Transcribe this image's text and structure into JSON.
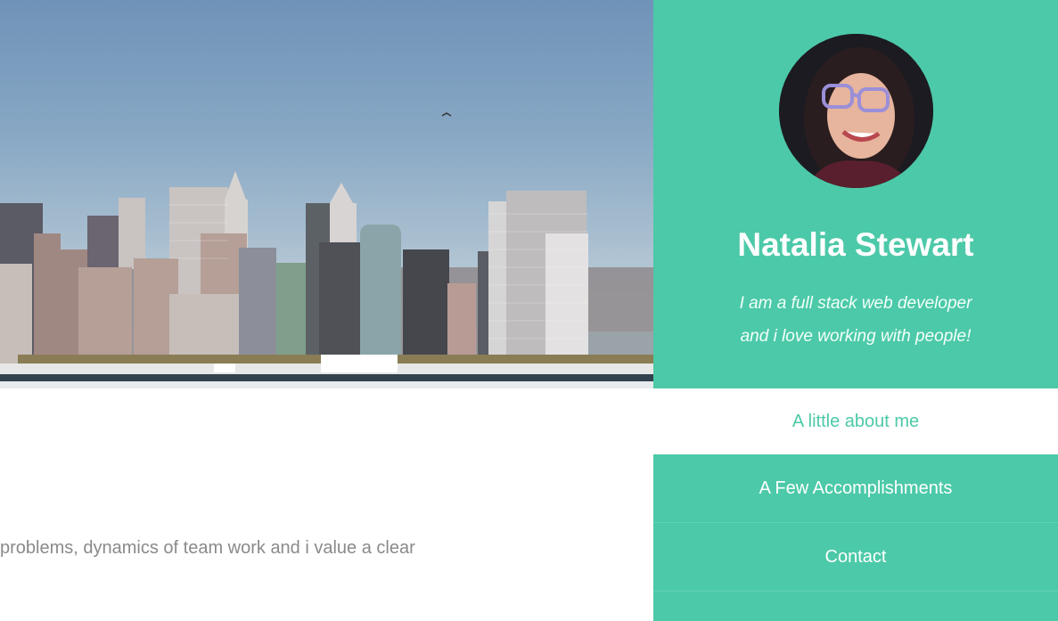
{
  "profile": {
    "name": "Natalia Stewart",
    "tagline_line1": "I am a full stack web developer",
    "tagline_line2": "and i love working with people!",
    "avatar_icon": "portrait-photo"
  },
  "nav": {
    "items": [
      {
        "label": "A little about me",
        "active": true
      },
      {
        "label": "A Few Accomplishments",
        "active": false
      },
      {
        "label": "Contact",
        "active": false
      }
    ]
  },
  "content": {
    "text": "problems, dynamics of team work and i value a clear"
  },
  "hero": {
    "image": "city-skyline-photo"
  },
  "colors": {
    "accent": "#4cc9a8",
    "text_gray": "#8a8a8a",
    "white": "#ffffff"
  }
}
